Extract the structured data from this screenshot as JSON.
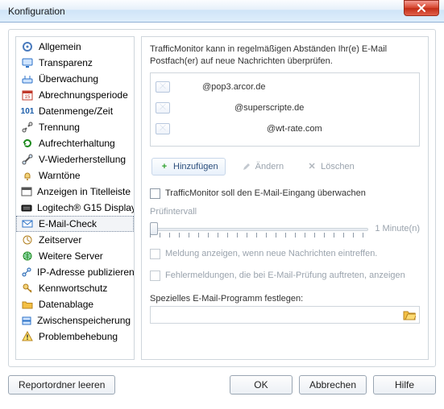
{
  "window": {
    "title": "Konfiguration"
  },
  "sidebar": {
    "items": [
      {
        "label": "Allgemein",
        "icon": "gear-icon",
        "color": "#4a7bbd"
      },
      {
        "label": "Transparenz",
        "icon": "monitor-icon",
        "color": "#2c72c7"
      },
      {
        "label": "Überwachung",
        "icon": "router-icon",
        "color": "#2c72c7"
      },
      {
        "label": "Abrechnungsperiode",
        "icon": "calendar-icon",
        "color": "#c0392b"
      },
      {
        "label": "Datenmenge/Zeit",
        "icon": "101-icon",
        "color": "#1d5fab"
      },
      {
        "label": "Trennung",
        "icon": "disconnect-icon",
        "color": "#555"
      },
      {
        "label": "Aufrechterhaltung",
        "icon": "refresh-icon",
        "color": "#1d8a1d"
      },
      {
        "label": "V-Wiederherstellung",
        "icon": "reconnect-icon",
        "color": "#555"
      },
      {
        "label": "Warntöne",
        "icon": "bell-icon",
        "color": "#b07d1a"
      },
      {
        "label": "Anzeigen in Titelleiste",
        "icon": "window-icon",
        "color": "#555"
      },
      {
        "label": "Logitech® G15 Display",
        "icon": "keyboard-icon",
        "color": "#555"
      },
      {
        "label": "E-Mail-Check",
        "icon": "mail-icon",
        "color": "#2c72c7",
        "selected": true
      },
      {
        "label": "Zeitserver",
        "icon": "clock-icon",
        "color": "#b07d1a"
      },
      {
        "label": "Weitere Server",
        "icon": "globe-icon",
        "color": "#1d8a1d"
      },
      {
        "label": "IP-Adresse publizieren",
        "icon": "network-icon",
        "color": "#1d5fab"
      },
      {
        "label": "Kennwortschutz",
        "icon": "key-icon",
        "color": "#b07d1a"
      },
      {
        "label": "Datenablage",
        "icon": "folder-icon",
        "color": "#e0b040"
      },
      {
        "label": "Zwischenspeicherung",
        "icon": "drive-icon",
        "color": "#2c72c7"
      },
      {
        "label": "Problembehebung",
        "icon": "warning-icon",
        "color": "#e6b000"
      }
    ]
  },
  "panel": {
    "intro": "TrafficMonitor kann in regelmäßigen Abständen Ihr(e) E-Mail Postfach(er) auf neue Nachrichten überprüfen.",
    "accounts": [
      {
        "address": "@pop3.arcor.de"
      },
      {
        "address": "@superscripte.de"
      },
      {
        "address": "@wt-rate.com"
      }
    ],
    "toolbar": {
      "add": "Hinzufügen",
      "edit": "Ändern",
      "delete": "Löschen"
    },
    "watch_checkbox": "TrafficMonitor soll den E-Mail-Eingang überwachen",
    "interval_label": "Prüfintervall",
    "interval_value": "1 Minute(n)",
    "notify_checkbox": "Meldung anzeigen, wenn neue Nachrichten eintreffen.",
    "errors_checkbox": "Fehlermeldungen, die bei E-Mail-Prüfung auftreten, anzeigen",
    "program_label": "Spezielles E-Mail-Programm festlegen:",
    "program_value": ""
  },
  "buttons": {
    "report": "Reportordner leeren",
    "ok": "OK",
    "cancel": "Abbrechen",
    "help": "Hilfe"
  }
}
